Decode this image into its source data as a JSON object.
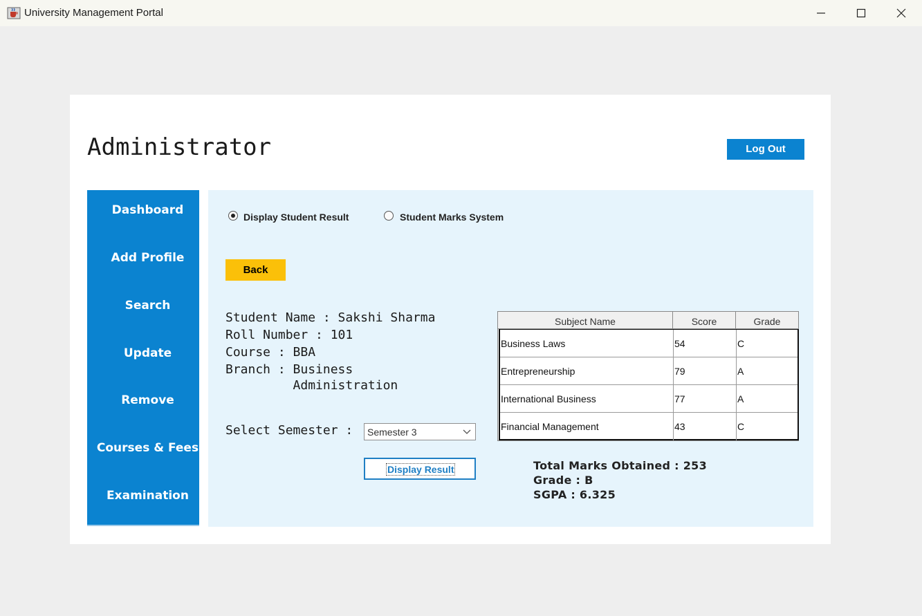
{
  "window": {
    "title": "University Management Portal",
    "icon": "java-cup-icon"
  },
  "header": {
    "title": "Administrator",
    "logout_label": "Log Out"
  },
  "sidebar": {
    "items": [
      {
        "label": "Dashboard"
      },
      {
        "label": "Add Profile"
      },
      {
        "label": "Search"
      },
      {
        "label": "Update"
      },
      {
        "label": "Remove"
      },
      {
        "label": "Courses & Fees"
      },
      {
        "label": "Examination"
      }
    ]
  },
  "mode": {
    "options": [
      {
        "label": "Display Student Result",
        "selected": true
      },
      {
        "label": "Student Marks System",
        "selected": false
      }
    ]
  },
  "back_label": "Back",
  "student": {
    "name_line": "Student Name : Sakshi Sharma",
    "roll_line": "Roll Number : 101",
    "course_line": "Course : BBA",
    "branch_line1": "Branch : Business",
    "branch_line2": "         Administration"
  },
  "semester": {
    "label": "Select Semester :",
    "selected": "Semester 3"
  },
  "display_result_label": "Display Result",
  "results_table": {
    "columns": [
      "Subject Name",
      "Score",
      "Grade"
    ],
    "rows": [
      [
        "Business Laws",
        "54",
        "C"
      ],
      [
        "Entrepreneurship",
        "79",
        "A"
      ],
      [
        "International Business",
        "77",
        "A"
      ],
      [
        "Financial Management",
        "43",
        "C"
      ]
    ]
  },
  "summary": {
    "total_line": "Total Marks Obtained : 253",
    "grade_line": "Grade : B",
    "sgpa_line": "SGPA : 6.325"
  },
  "colors": {
    "accent": "#0b83d0",
    "back_button": "#fbc009",
    "content_bg": "#e6f4fc"
  }
}
